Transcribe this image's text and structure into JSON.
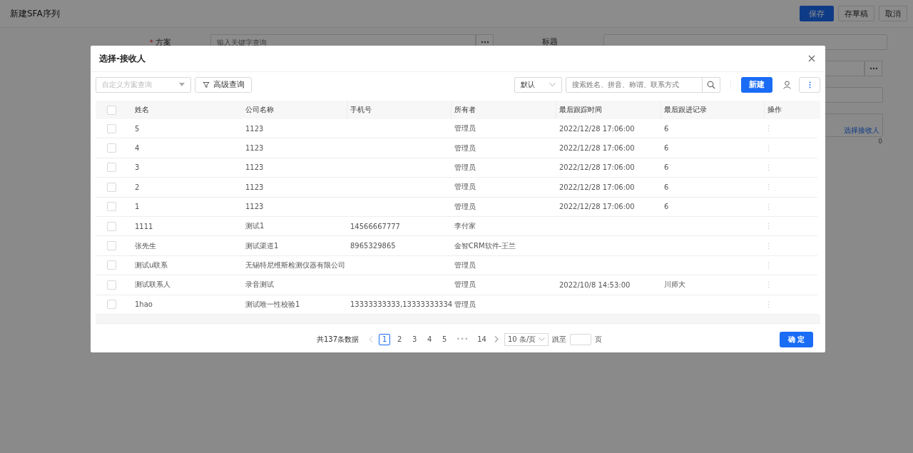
{
  "page": {
    "title": "新建SFA序列",
    "buttons": [
      {
        "label": "保存",
        "kind": "primary"
      },
      {
        "label": "存草稿",
        "kind": "default"
      },
      {
        "label": "取消",
        "kind": "default"
      }
    ]
  },
  "form": {
    "scheme_label": "方案",
    "required_mark": "*",
    "scheme_placeholder": "输入关键字查询",
    "title_label": "标题",
    "recipient_link": "选择接收人",
    "recipient_count": "0"
  },
  "dialog": {
    "title": "选择-接收人",
    "toolbar": {
      "view_placeholder": "自定义方案查询",
      "advanced_button": "高级查询",
      "sort_value": "默认",
      "search_placeholder": "搜索姓名、拼音、称谓、联系方式",
      "new_button": "新建"
    },
    "table": {
      "all_checked": false,
      "columns": [
        "姓名",
        "公司名称",
        "手机号",
        "所有者",
        "最后跟踪时间",
        "最后跟进记录",
        "操作"
      ],
      "rows": [
        {
          "checked": false,
          "cells": [
            "5",
            "1123",
            "",
            "管理员",
            "2022/12/28 17:06:00",
            "6"
          ]
        },
        {
          "checked": false,
          "cells": [
            "4",
            "1123",
            "",
            "管理员",
            "2022/12/28 17:06:00",
            "6"
          ]
        },
        {
          "checked": false,
          "cells": [
            "3",
            "1123",
            "",
            "管理员",
            "2022/12/28 17:06:00",
            "6"
          ]
        },
        {
          "checked": false,
          "cells": [
            "2",
            "1123",
            "",
            "管理员",
            "2022/12/28 17:06:00",
            "6"
          ]
        },
        {
          "checked": false,
          "cells": [
            "1",
            "1123",
            "",
            "管理员",
            "2022/12/28 17:06:00",
            "6"
          ]
        },
        {
          "checked": false,
          "cells": [
            "1111",
            "测试1",
            "14566667777",
            "李付家",
            "",
            ""
          ]
        },
        {
          "checked": false,
          "cells": [
            "张先生",
            "测试渠道1",
            "8965329865",
            "金智CRM软件-王兰",
            "",
            ""
          ]
        },
        {
          "checked": false,
          "cells": [
            "测试u联系",
            "无锡特尼维斯检测仪器有限公司",
            "",
            "管理员",
            "",
            ""
          ]
        },
        {
          "checked": false,
          "cells": [
            "测试联系人",
            "录音测试",
            "",
            "管理员",
            "2022/10/8 14:53:00",
            "川师大"
          ]
        },
        {
          "checked": false,
          "cells": [
            "1hao",
            "测试唯一性校验1",
            "13333333333,13333333334",
            "管理员",
            "",
            ""
          ]
        }
      ]
    },
    "pagination": {
      "total": "共137条数据",
      "pages": [
        {
          "label": "1",
          "kind": "page",
          "selected": true
        },
        {
          "label": "2",
          "kind": "page",
          "selected": false
        },
        {
          "label": "3",
          "kind": "page",
          "selected": false
        },
        {
          "label": "4",
          "kind": "page",
          "selected": false
        },
        {
          "label": "5",
          "kind": "page",
          "selected": false
        },
        {
          "label": "•••",
          "kind": "ellipsis"
        },
        {
          "label": "14",
          "kind": "page",
          "selected": false
        }
      ],
      "page_size": "10 条/页",
      "jump_label": "跳至",
      "page_unit": "页"
    },
    "confirm_button": "确 定"
  }
}
